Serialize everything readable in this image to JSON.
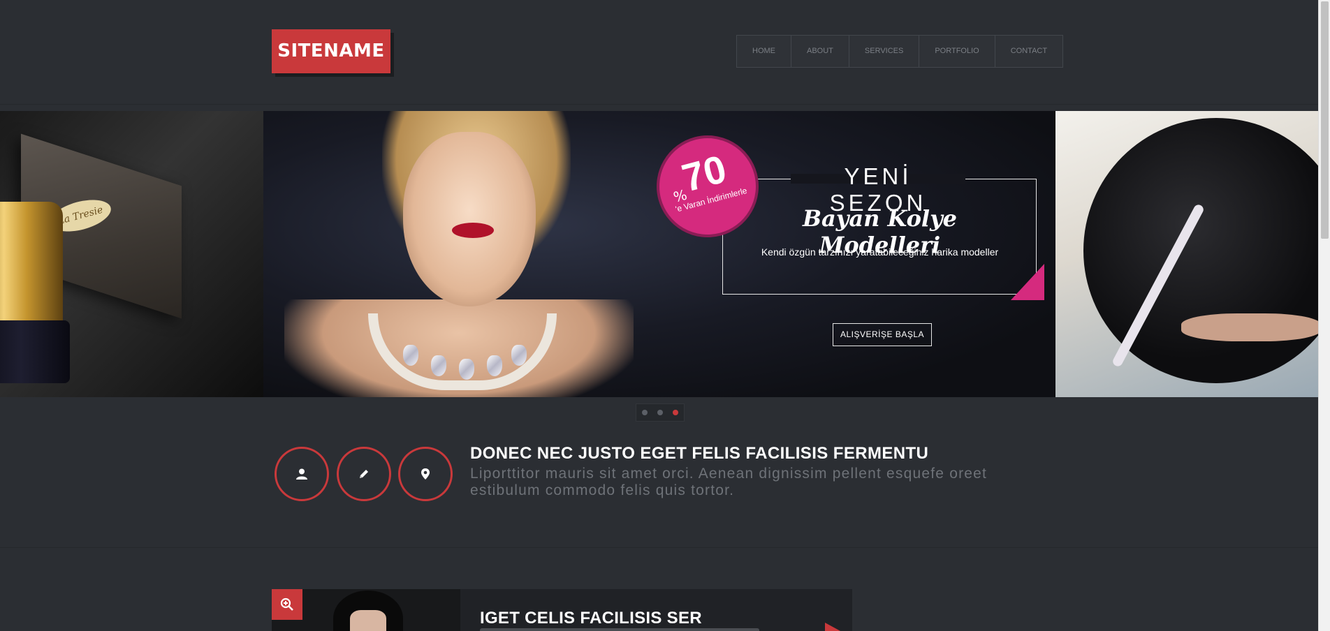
{
  "header": {
    "logo_text": "SITENAME",
    "nav": [
      "HOME",
      "ABOUT",
      "SERVICES",
      "PORTFOLIO",
      "CONTACT"
    ]
  },
  "slider": {
    "badge": {
      "percent_sign": "%",
      "number": "70",
      "caption": "'e Varan İndirimlerle"
    },
    "promo_title": "YENİ SEZON",
    "promo_subtitle": "Bayan Kolye Modelleri",
    "promo_desc": "Kendi özgün tarzınızı yaratabileceğiniz  harika modeller",
    "cta_label": "ALIŞVERİŞE BAŞLA",
    "box_label": "La Tresie",
    "dots": 3,
    "active_dot": 3
  },
  "features": {
    "icons": [
      "user-icon",
      "pencil-icon",
      "map-marker-icon"
    ],
    "heading": "DONEC NEC JUSTO EGET FELIS FACILISIS FERMENTU",
    "text": "Liporttitor mauris sit amet orci. Aenean dignissim pellent esquefe oreet estibulum commodo felis quis tortor."
  },
  "portfolio": {
    "title": "IGET CELIS FACILISIS SER",
    "zoom_icon": "zoom-in-icon"
  },
  "colors": {
    "background": "#2b2e33",
    "accent": "#c9393b",
    "promo_pink": "#d52a7e"
  }
}
